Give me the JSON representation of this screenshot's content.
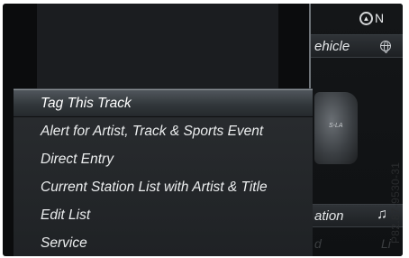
{
  "status_bar": {
    "icon": "navigation-compass-icon",
    "label": "N"
  },
  "background_panel": {
    "vehicle_fragment": "ehicle",
    "navigation_fragment": "ation",
    "car_badge": "S-LA",
    "bottom_left_fragment": "d",
    "bottom_right_fragment": "Li"
  },
  "menu": {
    "items": [
      {
        "label": "Tag This Track",
        "selected": true
      },
      {
        "label": "Alert for Artist, Track & Sports Event",
        "selected": false
      },
      {
        "label": "Direct Entry",
        "selected": false
      },
      {
        "label": "Current Station List with Artist & Title",
        "selected": false
      },
      {
        "label": "Edit List",
        "selected": false
      },
      {
        "label": "Service",
        "selected": false
      }
    ]
  },
  "reference_code": "P82.87-9530-31",
  "colors": {
    "screen_bg": "#0b0c0d",
    "menu_bg": "#2a2d30",
    "selected_bg": "#50565c",
    "text": "#eceeef"
  }
}
